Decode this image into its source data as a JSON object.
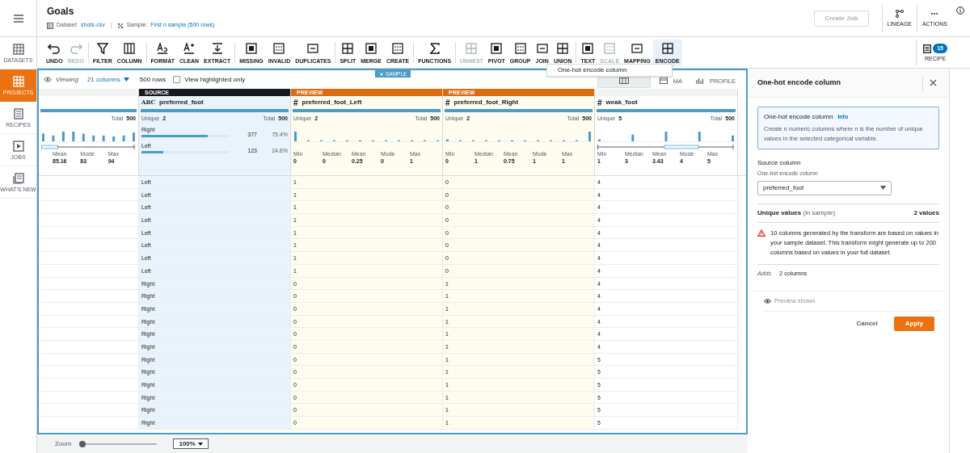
{
  "nav": {
    "items": [
      {
        "label": "DATASETS",
        "selected": false
      },
      {
        "label": "PROJECTS",
        "selected": true
      },
      {
        "label": "RECIPES",
        "selected": false
      },
      {
        "label": "JOBS",
        "selected": false
      },
      {
        "label": "WHAT'S NEW",
        "selected": false
      }
    ]
  },
  "header": {
    "title": "Goals",
    "dataset_label": "Dataset:",
    "dataset": "shots-csv",
    "sample_label": "Sample:",
    "sample": "First n sample (500 rows)",
    "create_job": {
      "label": "Create Job",
      "disabled": true
    },
    "actions": [
      "LINEAGE",
      "ACTIONS"
    ]
  },
  "toolbar": {
    "groups": [
      [
        {
          "label": "UNDO",
          "disabled": false,
          "selected": false
        },
        {
          "label": "REDO",
          "disabled": true,
          "selected": false
        }
      ],
      [
        {
          "label": "FILTER",
          "disabled": false,
          "selected": false
        },
        {
          "label": "COLUMN",
          "disabled": false,
          "selected": false
        }
      ],
      [
        {
          "label": "FORMAT",
          "disabled": false,
          "selected": false
        },
        {
          "label": "CLEAN",
          "disabled": false,
          "selected": false
        },
        {
          "label": "EXTRACT",
          "disabled": false,
          "selected": false
        }
      ],
      [
        {
          "label": "MISSING",
          "disabled": false,
          "selected": false
        },
        {
          "label": "INVALID",
          "disabled": false,
          "selected": false
        },
        {
          "label": "DUPLICATES",
          "disabled": false,
          "selected": false
        }
      ],
      [
        {
          "label": "SPLIT",
          "disabled": false,
          "selected": false
        },
        {
          "label": "MERGE",
          "disabled": false,
          "selected": false
        },
        {
          "label": "CREATE",
          "disabled": false,
          "selected": false
        }
      ],
      [
        {
          "label": "FUNCTIONS",
          "disabled": false,
          "selected": false
        }
      ],
      [
        {
          "label": "UNNEST",
          "disabled": true,
          "selected": false
        },
        {
          "label": "PIVOT",
          "disabled": false,
          "selected": false
        },
        {
          "label": "GROUP",
          "disabled": false,
          "selected": false
        },
        {
          "label": "JOIN",
          "disabled": false,
          "selected": false
        },
        {
          "label": "UNION",
          "disabled": false,
          "selected": false
        }
      ],
      [
        {
          "label": "TEXT",
          "disabled": false,
          "selected": false
        },
        {
          "label": "SCALE",
          "disabled": true,
          "selected": false
        },
        {
          "label": "MAPPING",
          "disabled": false,
          "selected": false
        },
        {
          "label": "ENCODE",
          "disabled": false,
          "selected": true
        }
      ]
    ],
    "recipe": {
      "label": "RECIPE",
      "count": "15"
    },
    "menu": {
      "items": [
        "One-hot encode column"
      ]
    }
  },
  "grid": {
    "viewing_label": "Viewing",
    "columns_select": "21 columns",
    "rows_count": "500 rows",
    "highlighted_only": {
      "label": "View highlighted only",
      "checked": false
    },
    "sample_tag": "SAMPLE",
    "views": [
      {
        "selected": true
      },
      {
        "label": "MA",
        "selected": false
      },
      {
        "label": "PROFILE",
        "selected": false
      }
    ],
    "columns": [
      {
        "total_label": "Total",
        "total": "500",
        "stats": [
          {
            "label": "Mean",
            "value": "85.16"
          },
          {
            "label": "Mode",
            "value": "83"
          },
          {
            "label": "Max",
            "value": "94"
          }
        ]
      },
      {
        "badge": "SOURCE",
        "type_symbol": "ABC",
        "name": "preferred_foot",
        "unique_label": "Unique",
        "unique": "2",
        "total_label": "Total",
        "total": "500",
        "categories": [
          {
            "label": "Right",
            "count": "377",
            "percent": "75.4%",
            "level": 0.754
          },
          {
            "label": "Left",
            "count": "123",
            "percent": "24.6%",
            "level": 0.246
          }
        ]
      },
      {
        "badge": "PREVIEW",
        "type_symbol": "#",
        "name": "preferred_foot_Left",
        "unique_label": "Unique",
        "unique": "2",
        "total_label": "Total",
        "total": "500",
        "stats": [
          {
            "label": "Min",
            "value": "0"
          },
          {
            "label": "Median",
            "value": "0"
          },
          {
            "label": "Mean",
            "value": "0.25"
          },
          {
            "label": "Mode",
            "value": "0"
          },
          {
            "label": "Max",
            "value": "1"
          }
        ]
      },
      {
        "badge": "PREVIEW",
        "type_symbol": "#",
        "name": "preferred_foot_Right",
        "unique_label": "Unique",
        "unique": "2",
        "total_label": "Total",
        "total": "500",
        "stats": [
          {
            "label": "Min",
            "value": "0"
          },
          {
            "label": "Median",
            "value": "1"
          },
          {
            "label": "Mean",
            "value": "0.75"
          },
          {
            "label": "Mode",
            "value": "1"
          },
          {
            "label": "Max",
            "value": "1"
          }
        ]
      },
      {
        "type_symbol": "#",
        "name": "weak_foot",
        "unique_label": "Unique",
        "unique": "5",
        "total_label": "Total",
        "total": "500",
        "stats": [
          {
            "label": "Min",
            "value": "1"
          },
          {
            "label": "Median",
            "value": "3"
          },
          {
            "label": "Mean",
            "value": "3.43"
          },
          {
            "label": "Mode",
            "value": "4"
          },
          {
            "label": "Max",
            "value": "5"
          }
        ]
      }
    ],
    "rows": [
      [
        "",
        "Left",
        "1",
        "0",
        "4"
      ],
      [
        "",
        "Left",
        "1",
        "0",
        "4"
      ],
      [
        "",
        "Left",
        "1",
        "0",
        "4"
      ],
      [
        "",
        "Left",
        "1",
        "0",
        "4"
      ],
      [
        "",
        "Left",
        "1",
        "0",
        "4"
      ],
      [
        "",
        "Left",
        "1",
        "0",
        "4"
      ],
      [
        "",
        "Left",
        "1",
        "0",
        "4"
      ],
      [
        "",
        "Left",
        "1",
        "0",
        "4"
      ],
      [
        "",
        "Right",
        "0",
        "1",
        "4"
      ],
      [
        "",
        "Right",
        "0",
        "1",
        "4"
      ],
      [
        "",
        "Right",
        "0",
        "1",
        "4"
      ],
      [
        "",
        "Right",
        "0",
        "1",
        "4"
      ],
      [
        "",
        "Right",
        "0",
        "1",
        "4"
      ],
      [
        "",
        "Right",
        "0",
        "1",
        "4"
      ],
      [
        "",
        "Right",
        "0",
        "1",
        "5"
      ],
      [
        "",
        "Right",
        "0",
        "1",
        "5"
      ],
      [
        "",
        "Right",
        "0",
        "1",
        "5"
      ],
      [
        "",
        "Right",
        "0",
        "1",
        "5"
      ],
      [
        "",
        "Right",
        "0",
        "1",
        "5"
      ],
      [
        "",
        "Right",
        "0",
        "1",
        "5"
      ]
    ]
  },
  "panel": {
    "title": "One-hot encode column",
    "info_title": "One-hot encode column",
    "info_link": "Info",
    "info_text": "Create n numeric columns where n is the number of unique values in the selected categorical variable.",
    "source_label": "Source column",
    "source_hint": "One-hot encode column",
    "source_value": "preferred_foot",
    "unique_label": "**Unique values** (in sample)",
    "unique_value": "2 values",
    "warning": "10 columns generated by the transform are based on values in your sample dataset. This transform might generate up to 200 columns based on values in your full dataset.",
    "adds_label": "Adds",
    "adds_value": "2 columns",
    "preview": "Preview shown",
    "buttons": [
      "Cancel",
      "Apply"
    ]
  },
  "zoom": {
    "label": "Zoom",
    "level": 0.0,
    "value": "100%"
  }
}
